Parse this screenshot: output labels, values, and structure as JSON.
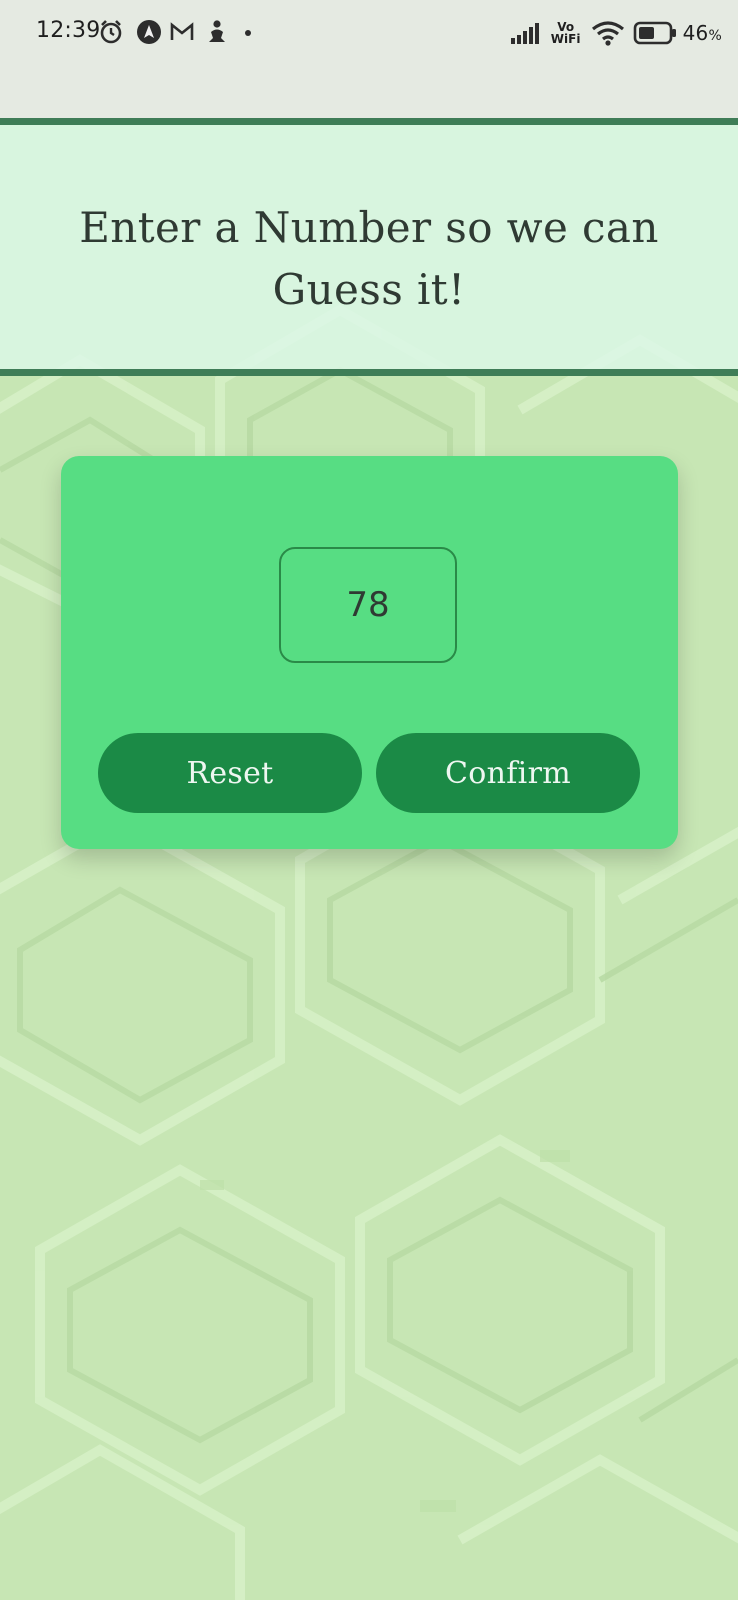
{
  "status_bar": {
    "time": "12:39",
    "battery_percent": "46",
    "battery_unit": "%",
    "vowifi_top": "Vo",
    "vowifi_bottom": "WiFi",
    "icons": [
      "alarm-icon",
      "navigation-icon",
      "gmail-icon",
      "person-icon",
      "signal-icon",
      "wifi-icon",
      "battery-icon"
    ]
  },
  "header": {
    "title": "Enter a Number so we can Guess it!"
  },
  "card": {
    "input_value": "78",
    "reset_label": "Reset",
    "confirm_label": "Confirm"
  },
  "colors": {
    "background": "#c7e6b4",
    "header_bg": "#dcf8e8",
    "header_border": "#3f7d57",
    "card": "#57dd83",
    "button": "#1b8a46",
    "input_border": "#2a8a48",
    "text": "#2f3a33"
  }
}
